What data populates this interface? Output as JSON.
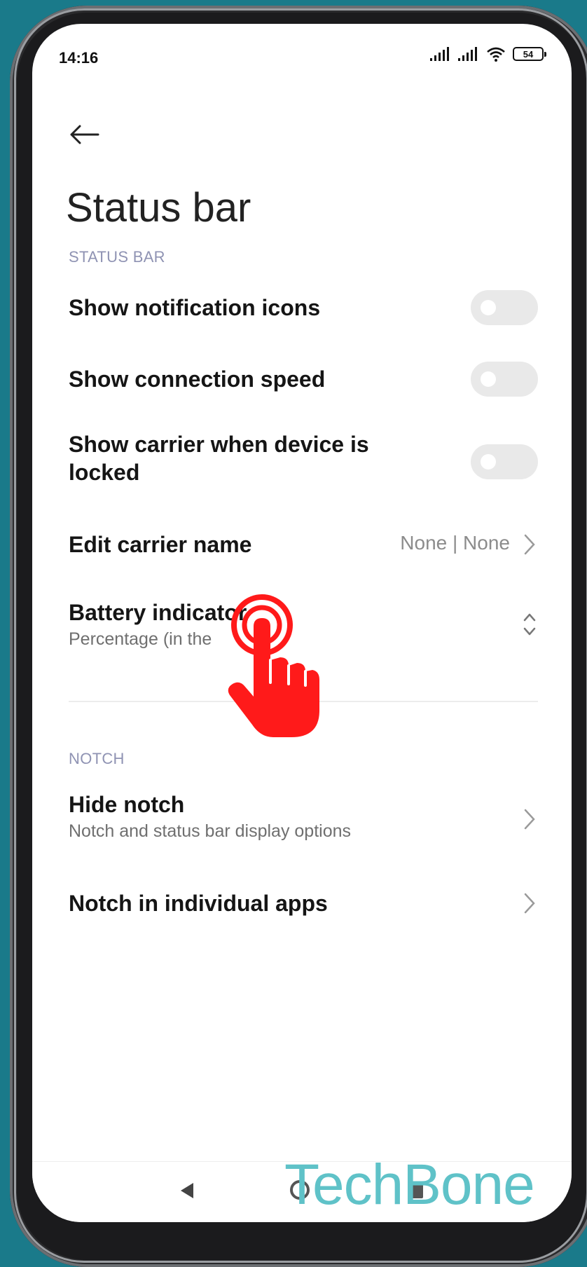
{
  "status_bar": {
    "time": "14:16",
    "battery": "54"
  },
  "header": {
    "title": "Status bar"
  },
  "sections": {
    "status_bar_label": "STATUS BAR",
    "notch_label": "NOTCH"
  },
  "rows": {
    "notification_icons": "Show notification icons",
    "connection_speed": "Show connection speed",
    "carrier_locked": "Show carrier when device is locked",
    "edit_carrier": "Edit carrier name",
    "edit_carrier_value": "None | None",
    "battery_indicator": "Battery indicator",
    "battery_indicator_sub": "Percentage (in the",
    "hide_notch": "Hide notch",
    "hide_notch_sub": "Notch and status bar display options",
    "notch_apps": "Notch in individual apps"
  },
  "watermark": "TechBone",
  "colors": {
    "background": "#1a7a8a",
    "section_label": "#8f93b3",
    "toggle_off": "#e9e9e9",
    "hand_pointer": "#ff1a1a",
    "watermark": "#5fc2c8"
  }
}
